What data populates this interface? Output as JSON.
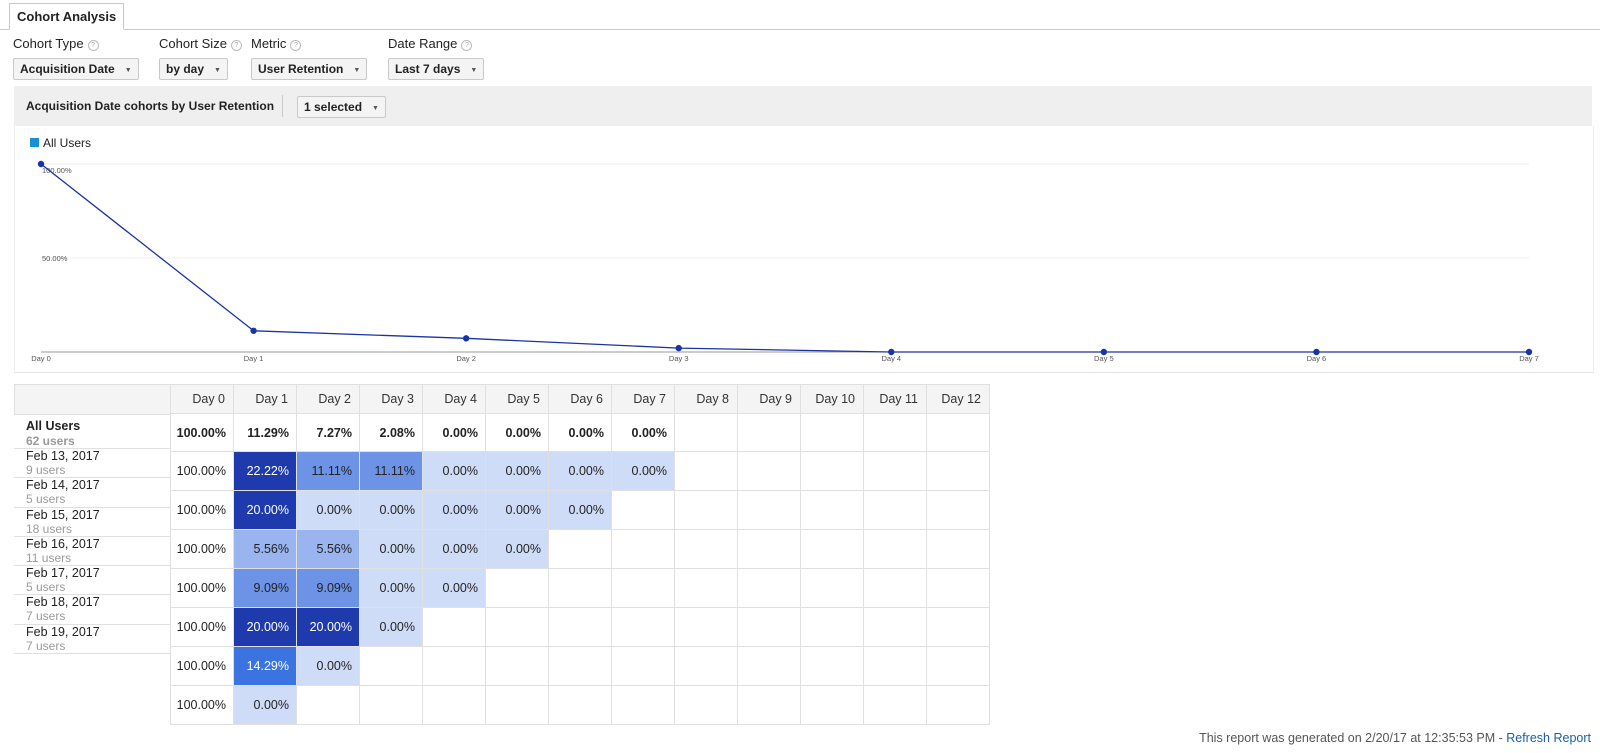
{
  "tab": {
    "label": "Cohort Analysis"
  },
  "controls": [
    {
      "label": "Cohort Type",
      "value": "Acquisition Date"
    },
    {
      "label": "Cohort Size",
      "value": "by day"
    },
    {
      "label": "Metric",
      "value": "User Retention"
    },
    {
      "label": "Date Range",
      "value": "Last 7 days"
    }
  ],
  "panel": {
    "title": "Acquisition Date cohorts by User Retention",
    "selector": "1 selected"
  },
  "chart_data": {
    "type": "line",
    "legend": "top-left",
    "grid": true,
    "x": [
      "Day 0",
      "Day 1",
      "Day 2",
      "Day 3",
      "Day 4",
      "Day 5",
      "Day 6",
      "Day 7"
    ],
    "series": [
      {
        "name": "All Users",
        "color": "#1a33a6",
        "values": [
          100,
          11.29,
          7.27,
          2.08,
          0,
          0,
          0,
          0
        ]
      }
    ],
    "y_ticks": [
      "100.00%",
      "50.00%"
    ],
    "ylim": [
      0,
      100
    ],
    "legend_color": "#1a8fd6"
  },
  "table": {
    "columns": [
      "Day 0",
      "Day 1",
      "Day 2",
      "Day 3",
      "Day 4",
      "Day 5",
      "Day 6",
      "Day 7",
      "Day 8",
      "Day 9",
      "Day 10",
      "Day 11",
      "Day 12"
    ],
    "total": {
      "label": "All Users",
      "users": "62 users",
      "values": [
        "100.00%",
        "11.29%",
        "7.27%",
        "2.08%",
        "0.00%",
        "0.00%",
        "0.00%",
        "0.00%",
        "",
        "",
        "",
        "",
        ""
      ]
    },
    "rows": [
      {
        "label": "Feb 13, 2017",
        "users": "9 users",
        "values": [
          "100.00%",
          "22.22%",
          "11.11%",
          "11.11%",
          "0.00%",
          "0.00%",
          "0.00%",
          "0.00%"
        ]
      },
      {
        "label": "Feb 14, 2017",
        "users": "5 users",
        "values": [
          "100.00%",
          "20.00%",
          "0.00%",
          "0.00%",
          "0.00%",
          "0.00%",
          "0.00%"
        ]
      },
      {
        "label": "Feb 15, 2017",
        "users": "18 users",
        "values": [
          "100.00%",
          "5.56%",
          "5.56%",
          "0.00%",
          "0.00%",
          "0.00%"
        ]
      },
      {
        "label": "Feb 16, 2017",
        "users": "11 users",
        "values": [
          "100.00%",
          "9.09%",
          "9.09%",
          "0.00%",
          "0.00%"
        ]
      },
      {
        "label": "Feb 17, 2017",
        "users": "5 users",
        "values": [
          "100.00%",
          "20.00%",
          "20.00%",
          "0.00%"
        ]
      },
      {
        "label": "Feb 18, 2017",
        "users": "7 users",
        "values": [
          "100.00%",
          "14.29%",
          "0.00%"
        ]
      },
      {
        "label": "Feb 19, 2017",
        "users": "7 users",
        "values": [
          "100.00%",
          "0.00%"
        ]
      }
    ],
    "heat_colors": {
      "zero": "#cfdcf7",
      "low": "#9ab4ef",
      "mid": "#6c93e6",
      "high": "#3b74e0",
      "max": "#1e3aad"
    }
  },
  "footer": {
    "text": "This report was generated on 2/20/17 at 12:35:53 PM - ",
    "link": "Refresh Report"
  }
}
